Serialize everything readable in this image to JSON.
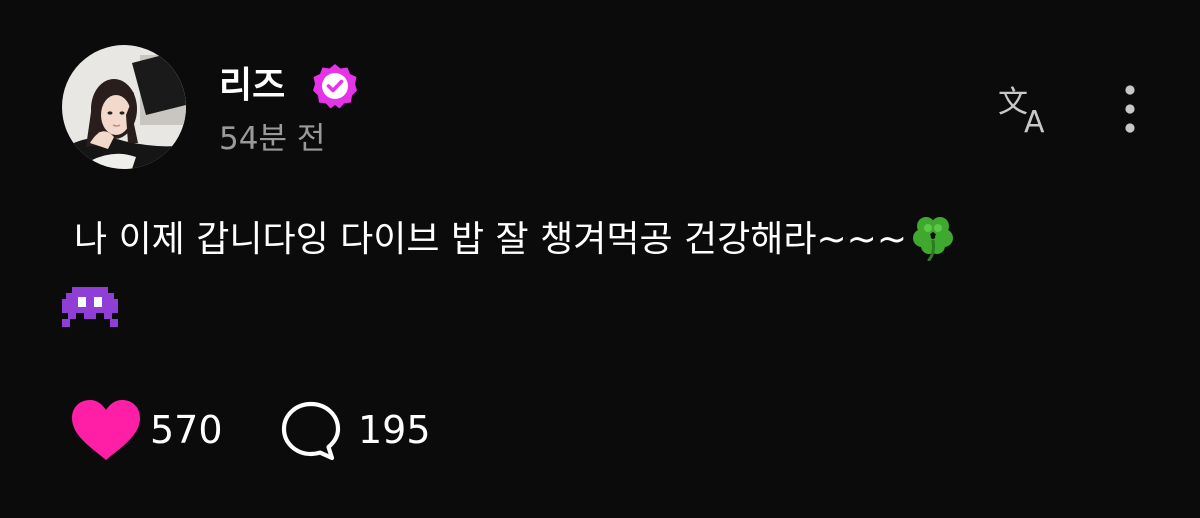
{
  "post": {
    "author": {
      "name": "리즈",
      "verified": true,
      "badge_color": "#e433e8",
      "avatar_icon": "profile-photo"
    },
    "timestamp": "54분 전",
    "header_actions": [
      {
        "icon": "translate-icon"
      },
      {
        "icon": "more-vertical-icon"
      }
    ],
    "text": "나 이제 갑니다잉 다이브 밥 잘 챙겨먹공 건강해라~~~",
    "emojis": [
      "four-leaf-clover",
      "alien-monster"
    ],
    "stats": {
      "likes": "570",
      "comments": "195"
    },
    "colors": {
      "background": "#0b0b0b",
      "heart": "#ff1fa6",
      "muted_text": "#9a9a9a"
    }
  }
}
